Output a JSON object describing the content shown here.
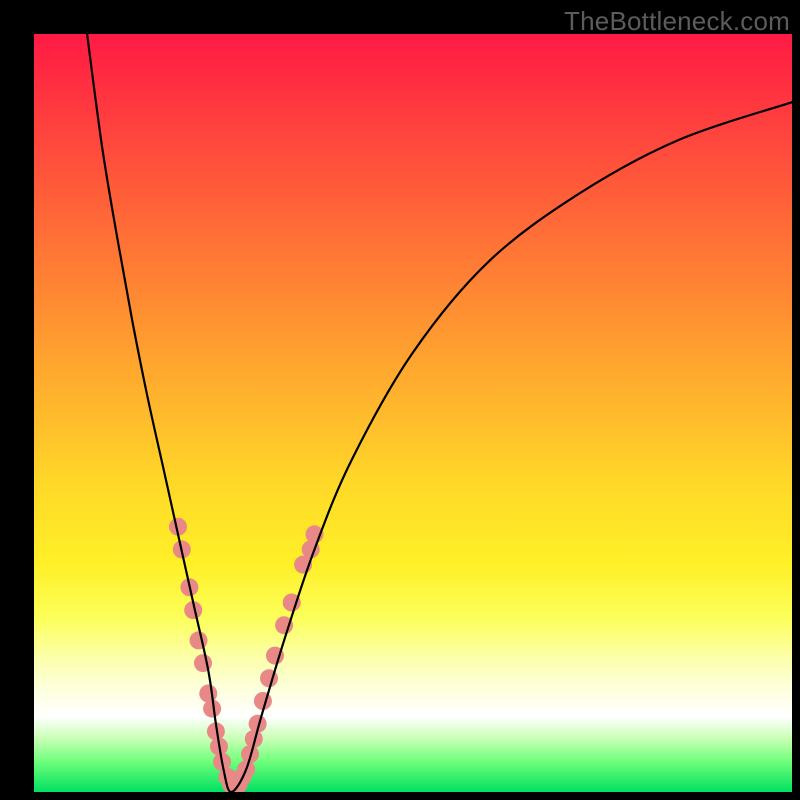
{
  "watermark": "TheBottleneck.com",
  "chart_data": {
    "type": "line",
    "title": "",
    "xlabel": "",
    "ylabel": "",
    "xlim": [
      0,
      100
    ],
    "ylim": [
      0,
      100
    ],
    "grid": false,
    "legend": false,
    "background": {
      "type": "vertical-gradient",
      "stops": [
        {
          "pos": 0,
          "color": "#ff1a44"
        },
        {
          "pos": 50,
          "color": "#ffba2c"
        },
        {
          "pos": 77,
          "color": "#fcff5a"
        },
        {
          "pos": 90,
          "color": "#ffffff"
        },
        {
          "pos": 100,
          "color": "#00e060"
        }
      ]
    },
    "series": [
      {
        "name": "bottleneck-curve",
        "color": "#000000",
        "x": [
          7,
          9,
          11,
          13,
          15,
          17,
          19,
          21,
          23,
          24,
          25,
          26,
          28,
          30,
          33,
          37,
          42,
          50,
          60,
          72,
          85,
          100
        ],
        "values": [
          100,
          85,
          73,
          62,
          52,
          43,
          34,
          25,
          16,
          9,
          3,
          0,
          3,
          10,
          20,
          32,
          44,
          58,
          70,
          79,
          86,
          91
        ]
      }
    ],
    "markers": {
      "name": "highlight-dots",
      "color": "#e98987",
      "radius_px": 9,
      "points": [
        {
          "x": 19.0,
          "y": 35
        },
        {
          "x": 19.5,
          "y": 32
        },
        {
          "x": 20.5,
          "y": 27
        },
        {
          "x": 21.0,
          "y": 24
        },
        {
          "x": 21.7,
          "y": 20
        },
        {
          "x": 22.3,
          "y": 17
        },
        {
          "x": 23.0,
          "y": 13
        },
        {
          "x": 23.5,
          "y": 11
        },
        {
          "x": 24.0,
          "y": 8
        },
        {
          "x": 24.4,
          "y": 6
        },
        {
          "x": 24.8,
          "y": 4
        },
        {
          "x": 25.5,
          "y": 2
        },
        {
          "x": 26.0,
          "y": 1
        },
        {
          "x": 26.5,
          "y": 1
        },
        {
          "x": 27.0,
          "y": 1
        },
        {
          "x": 27.5,
          "y": 2
        },
        {
          "x": 28.0,
          "y": 3
        },
        {
          "x": 28.5,
          "y": 5
        },
        {
          "x": 29.0,
          "y": 7
        },
        {
          "x": 29.5,
          "y": 9
        },
        {
          "x": 30.2,
          "y": 12
        },
        {
          "x": 31.0,
          "y": 15
        },
        {
          "x": 31.8,
          "y": 18
        },
        {
          "x": 33.0,
          "y": 22
        },
        {
          "x": 34.0,
          "y": 25
        },
        {
          "x": 35.5,
          "y": 30
        },
        {
          "x": 36.5,
          "y": 32
        },
        {
          "x": 37.0,
          "y": 34
        }
      ]
    }
  }
}
